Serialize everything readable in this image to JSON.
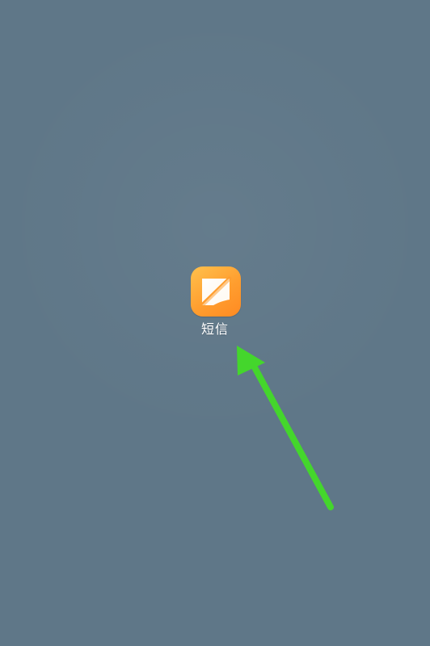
{
  "desktop": {
    "apps": [
      {
        "label": "短信",
        "icon": "messages-icon"
      }
    ]
  },
  "annotation": {
    "icon": "green-arrow-icon",
    "color": "#44d62c"
  }
}
